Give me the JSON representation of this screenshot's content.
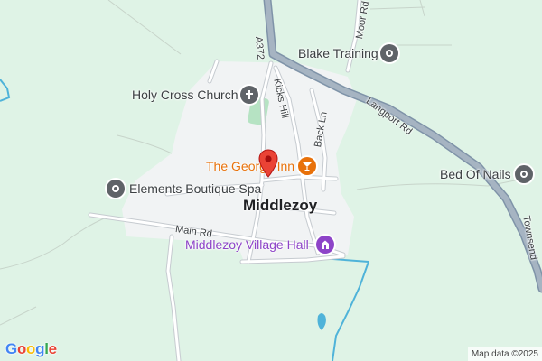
{
  "map": {
    "colors": {
      "land": "#dff3e6",
      "town": "#f1f3f4",
      "road": "#ffffff",
      "road_outline": "#c6cbd0",
      "major_road": "#a6b4c2",
      "major_road_outline": "#7f93a8",
      "water": "#4fb3d9",
      "park": "#b6e3c3",
      "pin_red": "#ea4335",
      "poi_grey": "#5f6368",
      "poi_orange": "#e8710a",
      "poi_purple": "#8e44c8"
    },
    "town_name": "Middlezoy",
    "places": [
      {
        "name": "Blake Training",
        "icon": "pin-icon",
        "color": "#5f6368"
      },
      {
        "name": "Holy Cross Church",
        "icon": "church-icon",
        "color": "#5f6368"
      },
      {
        "name": "The George Inn",
        "icon": "cocktail-icon",
        "color": "#e8710a"
      },
      {
        "name": "Bed Of Nails",
        "icon": "pin-icon",
        "color": "#5f6368"
      },
      {
        "name": "Elements Boutique Spa",
        "icon": "pin-icon",
        "color": "#5f6368"
      },
      {
        "name": "Middlezoy Village Hall",
        "icon": "building-icon",
        "color": "#8e44c8"
      }
    ],
    "roads": {
      "a372": "A372",
      "moor_rd": "Moor Rd",
      "kicks_hill": "Kicks Hill",
      "back_ln": "Back Ln",
      "langport_rd": "Langport Rd",
      "main_rd": "Main Rd",
      "townsend": "Townsend"
    },
    "attribution": "Map data ©2025",
    "logo": "Google"
  }
}
